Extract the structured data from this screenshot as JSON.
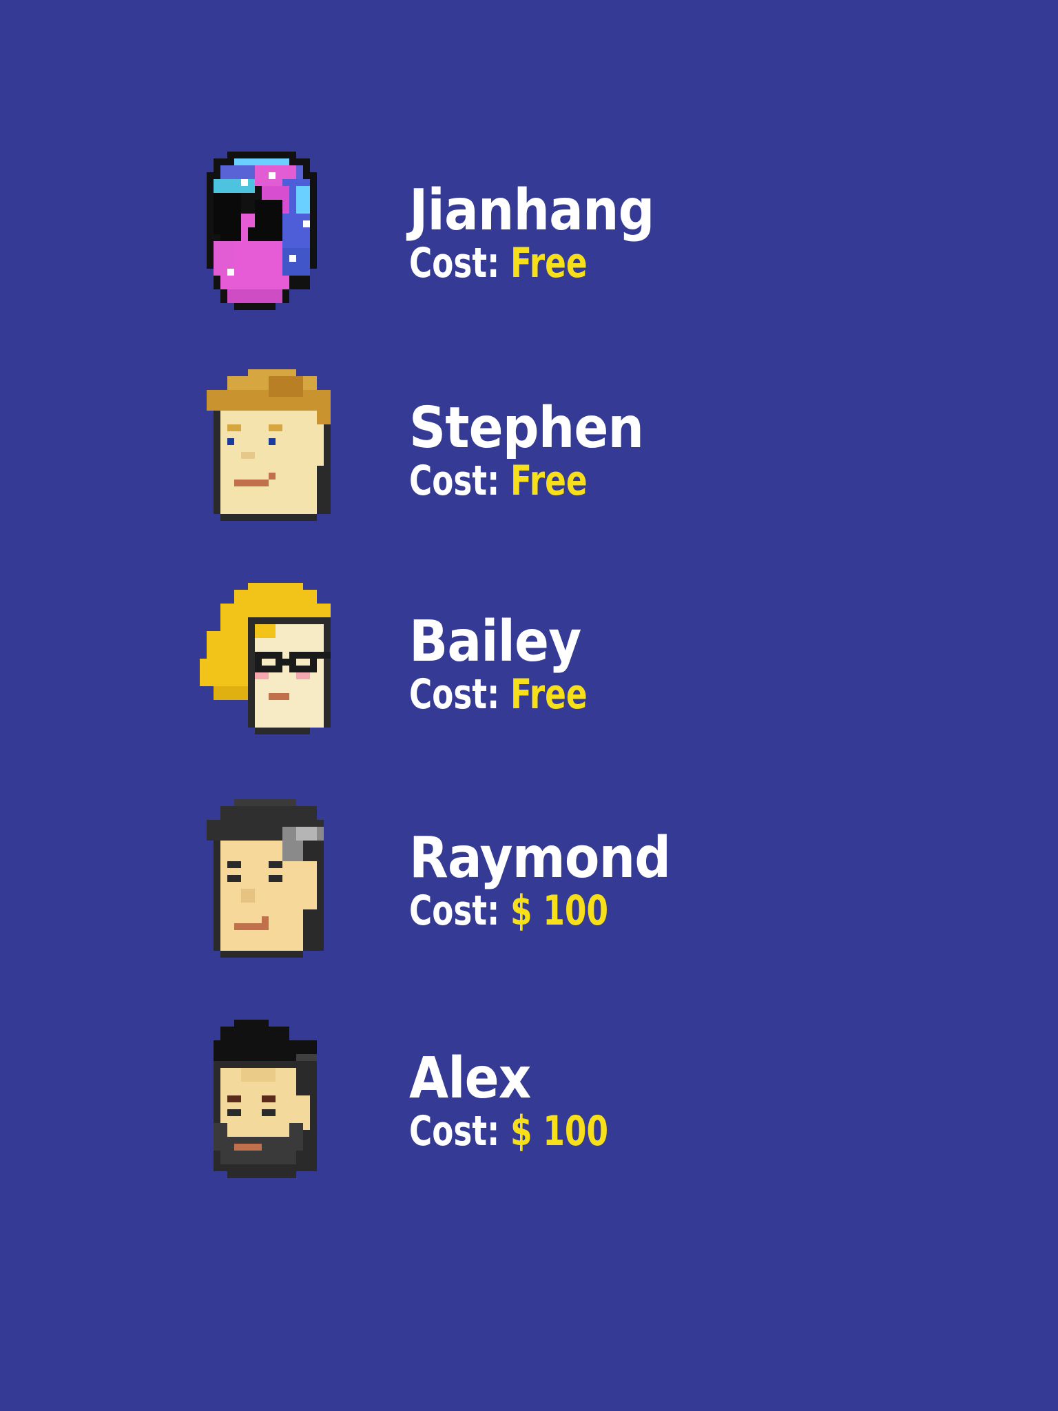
{
  "colors": {
    "background": "#353b95",
    "name_text": "#ffffff",
    "cost_label": "#ffffff",
    "cost_value": "#f7e01a"
  },
  "characters": [
    {
      "name": "Jianhang",
      "cost_label": "Cost:",
      "cost_value": "Free",
      "avatar_icon": "alien-galaxy-face-icon"
    },
    {
      "name": "Stephen",
      "cost_label": "Cost:",
      "cost_value": "Free",
      "avatar_icon": "blonde-boy-face-icon"
    },
    {
      "name": "Bailey",
      "cost_label": "Cost:",
      "cost_value": "Free",
      "avatar_icon": "blonde-girl-glasses-face-icon"
    },
    {
      "name": "Raymond",
      "cost_label": "Cost:",
      "cost_value": "$ 100",
      "avatar_icon": "dark-hair-grey-streak-face-icon"
    },
    {
      "name": "Alex",
      "cost_label": "Cost:",
      "cost_value": "$ 100",
      "avatar_icon": "bearded-man-face-icon"
    }
  ]
}
